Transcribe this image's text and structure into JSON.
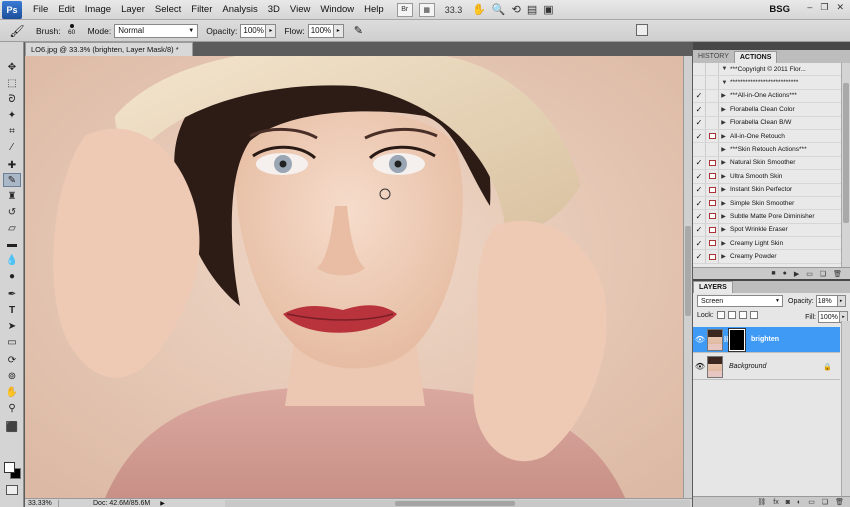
{
  "app": {
    "logo": "Ps",
    "menu": [
      "File",
      "Edit",
      "Image",
      "Layer",
      "Select",
      "Filter",
      "Analysis",
      "3D",
      "View",
      "Window",
      "Help"
    ],
    "bridge_label": "Br",
    "zoom_level": "33.3",
    "workspace": "BSG"
  },
  "options_bar": {
    "brush_label": "Brush:",
    "brush_size": "60",
    "mode_label": "Mode:",
    "mode_value": "Normal",
    "opacity_label": "Opacity:",
    "opacity_value": "100%",
    "flow_label": "Flow:",
    "flow_value": "100%"
  },
  "document": {
    "tab_title": "LO6.jpg @ 33.3% (brighten, Layer Mask/8) *",
    "status_zoom": "33.33%",
    "status_doc": "Doc: 42.6M/85.6M"
  },
  "panels": {
    "tabs": [
      "HISTORY",
      "ACTIONS"
    ],
    "active_tab": "ACTIONS",
    "actions": [
      {
        "label": "***Copyright © 2011 Flor...",
        "checked": false,
        "dialog": false,
        "type": "set"
      },
      {
        "label": "***************************",
        "checked": false,
        "dialog": false,
        "type": "set"
      },
      {
        "label": "***All-in-One Actions***",
        "checked": true,
        "dialog": false,
        "type": "action"
      },
      {
        "label": "Florabella Clean Color",
        "checked": true,
        "dialog": false,
        "type": "action"
      },
      {
        "label": "Florabella Clean B/W",
        "checked": true,
        "dialog": false,
        "type": "action"
      },
      {
        "label": "All-in-One Retouch",
        "checked": true,
        "dialog": true,
        "type": "action"
      },
      {
        "label": "***Skin Retouch Actions***",
        "checked": false,
        "dialog": false,
        "type": "action"
      },
      {
        "label": "Natural Skin Smoother",
        "checked": true,
        "dialog": true,
        "type": "action"
      },
      {
        "label": "Ultra Smooth Skin",
        "checked": true,
        "dialog": true,
        "type": "action"
      },
      {
        "label": "Instant Skin Perfector",
        "checked": true,
        "dialog": true,
        "type": "action"
      },
      {
        "label": "Simple Skin Smoother",
        "checked": true,
        "dialog": true,
        "type": "action"
      },
      {
        "label": "Subtle Matte Pore Diminisher",
        "checked": true,
        "dialog": true,
        "type": "action"
      },
      {
        "label": "Spot Wrinkle Eraser",
        "checked": true,
        "dialog": true,
        "type": "action"
      },
      {
        "label": "Creamy Light Skin",
        "checked": true,
        "dialog": true,
        "type": "action"
      },
      {
        "label": "Creamy Powder",
        "checked": true,
        "dialog": true,
        "type": "action"
      }
    ]
  },
  "layers": {
    "title": "LAYERS",
    "blend_mode": "Screen",
    "opacity_label": "Opacity:",
    "opacity_value": "18%",
    "lock_label": "Lock:",
    "fill_label": "Fill:",
    "fill_value": "100%",
    "items": [
      {
        "name": "brighten",
        "selected": true,
        "has_mask": true
      },
      {
        "name": "Background",
        "selected": false,
        "has_mask": false,
        "locked": true
      }
    ]
  }
}
